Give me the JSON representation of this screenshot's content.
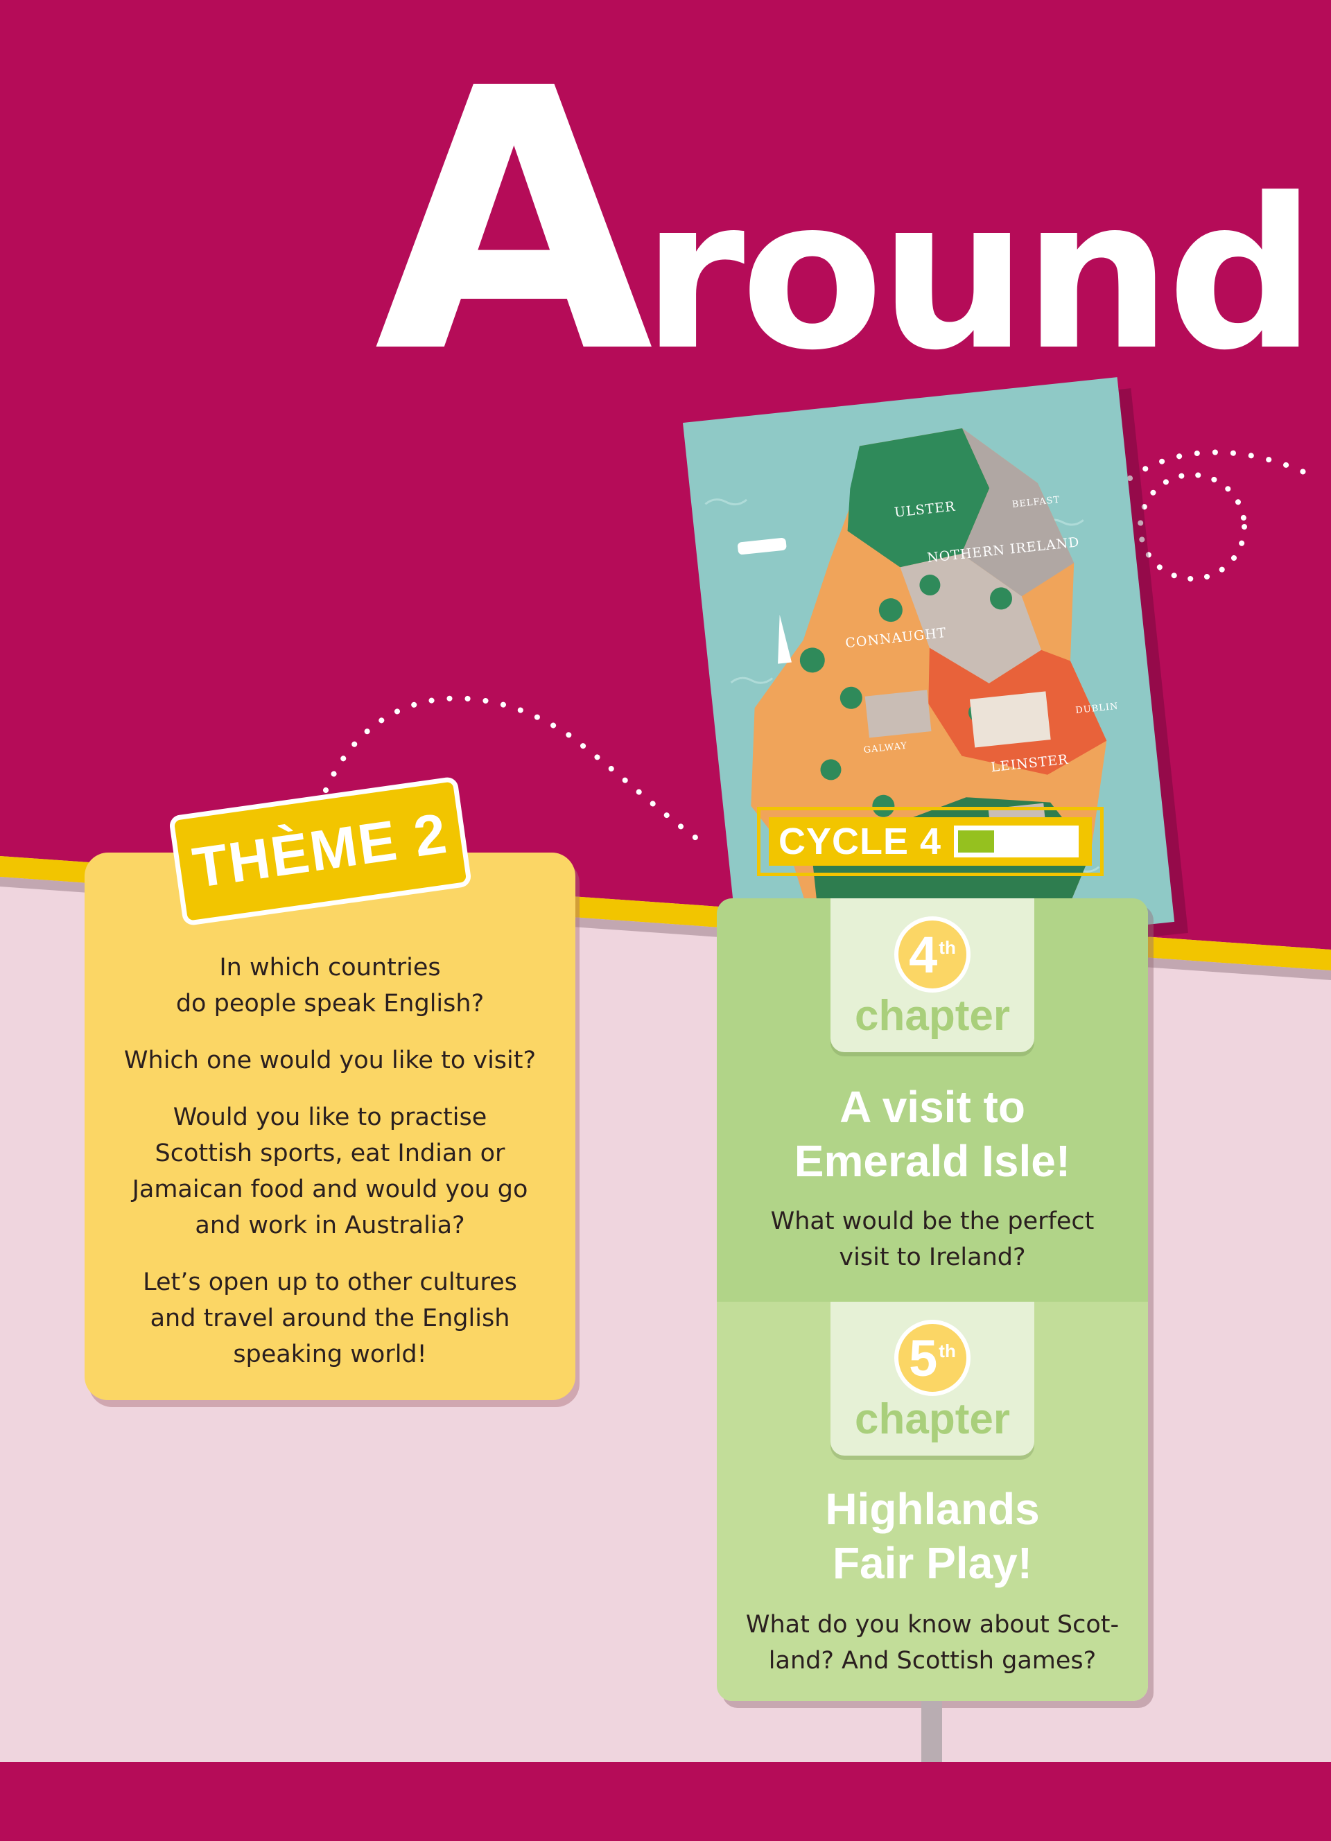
{
  "header": {
    "title_first": "A",
    "title_rest": "round"
  },
  "map": {
    "labels": {
      "ulster": "ULSTER",
      "belfast": "BELFAST",
      "northern_ireland": "NOTHERN IRELAND",
      "connaught": "CONNAUGHT",
      "galway": "GALWAY",
      "leinster": "LEINSTER",
      "dublin": "DUBLIN"
    }
  },
  "cycle_badge": {
    "label": "CYCLE 4",
    "progress": 0.3
  },
  "theme": {
    "badge": "THÈME 2",
    "paragraphs": [
      "In which countries\ndo people speak English?",
      "Which one would you like to visit?",
      "Would you like to practise\nScottish sports, eat Indian or\nJamaican food and would you go\nand work in Australia?",
      "Let’s open up to other cultures\nand travel around the English\nspeaking world!"
    ]
  },
  "chapters": [
    {
      "number": "4",
      "suffix": "th",
      "word": "chapter",
      "title": "A visit to\nEmerald Isle!",
      "question": "What would be the perfect\nvisit to Ireland?"
    },
    {
      "number": "5",
      "suffix": "th",
      "word": "chapter",
      "title": "Highlands\nFair Play!",
      "question": "What do you know about Scot-\nland? And Scottish games?"
    }
  ],
  "colors": {
    "magenta": "#b50c58",
    "pink_bg": "#efd5de",
    "yellow": "#f2c500",
    "card_yellow": "#fbd665",
    "green_dark": "#b1d488",
    "green_light": "#c2dd99",
    "progress_green": "#95c11f"
  }
}
